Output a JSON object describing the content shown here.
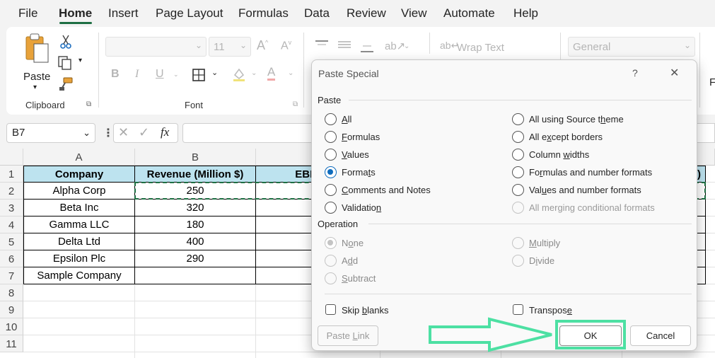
{
  "menu": {
    "items": [
      "File",
      "Home",
      "Insert",
      "Page Layout",
      "Formulas",
      "Data",
      "Review",
      "View",
      "Automate",
      "Help"
    ]
  },
  "ribbon": {
    "clipboard": {
      "paste_label": "Paste",
      "group_label": "Clipboard"
    },
    "font": {
      "font_size": "11",
      "group_label": "Font",
      "bold": "B",
      "italic": "I",
      "underline": "U"
    },
    "alignment": {
      "wrap_text": "Wrap Text"
    },
    "number": {
      "format": "General"
    },
    "cut_off_letter": "F"
  },
  "formula_bar": {
    "name_box": "B7",
    "fx": "fx"
  },
  "sheet": {
    "columns": [
      "A",
      "B"
    ],
    "rows": [
      "1",
      "2",
      "3",
      "4",
      "5",
      "6",
      "7",
      "8",
      "9",
      "10",
      "11"
    ],
    "headers": [
      "Company",
      "Revenue (Million $)",
      "EBITDA (",
      "",
      ")"
    ],
    "data": [
      [
        "Alpha Corp",
        "250"
      ],
      [
        "Beta Inc",
        "320"
      ],
      [
        "Gamma LLC",
        "180"
      ],
      [
        "Delta Ltd",
        "400"
      ],
      [
        "Epsilon Plc",
        "290"
      ],
      [
        "Sample Company",
        ""
      ]
    ]
  },
  "dialog": {
    "title": "Paste Special",
    "help": "?",
    "close": "✕",
    "paste_section": "Paste",
    "paste_left": [
      {
        "pre": "",
        "u": "A",
        "post": "ll"
      },
      {
        "pre": "",
        "u": "F",
        "post": "ormulas"
      },
      {
        "pre": "",
        "u": "V",
        "post": "alues"
      },
      {
        "pre": "Forma",
        "u": "t",
        "post": "s"
      },
      {
        "pre": "",
        "u": "C",
        "post": "omments and Notes"
      },
      {
        "pre": "Validatio",
        "u": "n",
        "post": ""
      }
    ],
    "paste_right": [
      {
        "pre": "All using Source t",
        "u": "h",
        "post": "eme"
      },
      {
        "pre": "All e",
        "u": "x",
        "post": "cept borders"
      },
      {
        "pre": "Column ",
        "u": "w",
        "post": "idths"
      },
      {
        "pre": "Fo",
        "u": "r",
        "post": "mulas and number formats"
      },
      {
        "pre": "Val",
        "u": "u",
        "post": "es and number formats"
      },
      {
        "pre": "All merging conditional formats",
        "u": "",
        "post": ""
      }
    ],
    "selected_paste": "Formats",
    "operation_section": "Operation",
    "op_left": [
      {
        "pre": "N",
        "u": "o",
        "post": "ne"
      },
      {
        "pre": "A",
        "u": "d",
        "post": "d"
      },
      {
        "pre": "",
        "u": "S",
        "post": "ubtract"
      }
    ],
    "op_right": [
      {
        "pre": "",
        "u": "M",
        "post": "ultiply"
      },
      {
        "pre": "D",
        "u": "i",
        "post": "vide"
      }
    ],
    "skip_blanks": {
      "pre": "Skip ",
      "u": "b",
      "post": "lanks"
    },
    "transpose": {
      "pre": "Transpos",
      "u": "e",
      "post": ""
    },
    "paste_link": {
      "pre": "Paste ",
      "u": "L",
      "post": "ink"
    },
    "ok": "OK",
    "cancel": "Cancel"
  },
  "colors": {
    "accent": "#0f6cbd",
    "header_fill": "#bde3ef",
    "highlight": "#4de0a3",
    "excel_green": "#1e6f43"
  }
}
